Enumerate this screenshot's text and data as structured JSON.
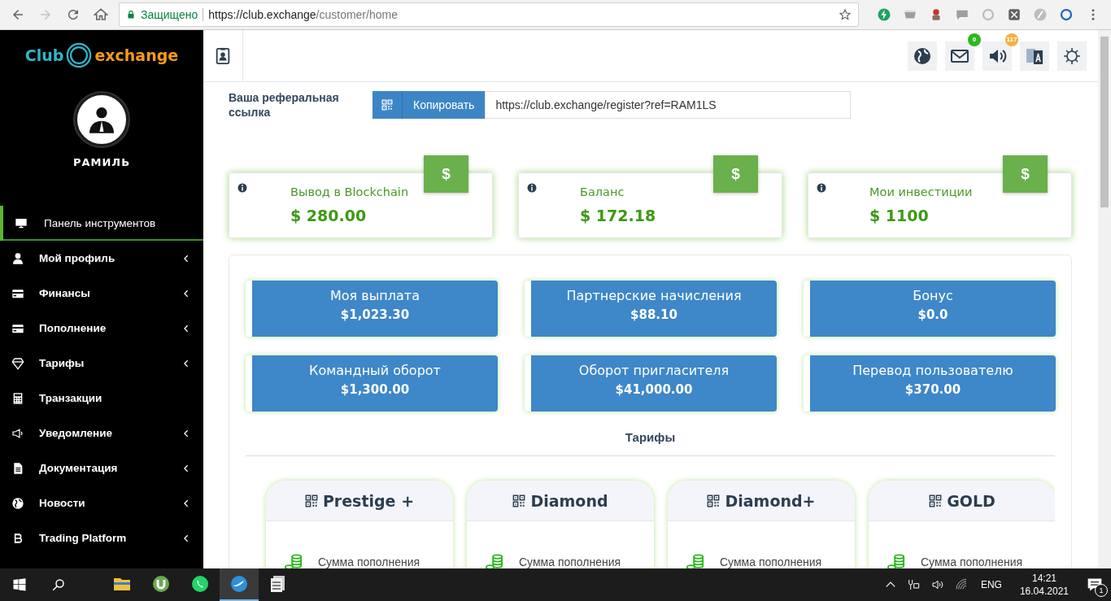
{
  "browser": {
    "secure_label": "Защищено",
    "url_host": "https://club.exchange",
    "url_path": "/customer/home",
    "extensions": [
      {
        "kind": "bolt",
        "color": "#1aa260"
      },
      {
        "kind": "cup",
        "color": "#9e9e9e"
      },
      {
        "kind": "figure",
        "color": "#c0392b"
      },
      {
        "kind": "chat",
        "color": "#9e9e9e"
      },
      {
        "kind": "ring",
        "color": "#bdbdbd"
      },
      {
        "kind": "square",
        "color": "#616161"
      },
      {
        "kind": "slash",
        "color": "#bdbdbd"
      },
      {
        "kind": "ring",
        "color": "#1e63c9"
      }
    ]
  },
  "sidebar": {
    "logo": {
      "part1": "Club",
      "part2": "exchange"
    },
    "user_name": "РАМИЛЬ",
    "items": [
      {
        "label": "Панель инструментов",
        "kind": "monitor",
        "selected": true,
        "submenu": false
      },
      {
        "label": "Мой профиль",
        "kind": "user",
        "selected": false,
        "submenu": true
      },
      {
        "label": "Финансы",
        "kind": "card",
        "selected": false,
        "submenu": true
      },
      {
        "label": "Пополнение",
        "kind": "card",
        "selected": false,
        "submenu": true
      },
      {
        "label": "Тарифы",
        "kind": "diamond",
        "selected": false,
        "submenu": true
      },
      {
        "label": "Транзакции",
        "kind": "calculator",
        "selected": false,
        "submenu": false
      },
      {
        "label": "Уведомление",
        "kind": "megaphone",
        "selected": false,
        "submenu": true
      },
      {
        "label": "Документация",
        "kind": "file",
        "selected": false,
        "submenu": true
      },
      {
        "label": "Новости",
        "kind": "globe",
        "selected": false,
        "submenu": true
      },
      {
        "label": "Trading Platform",
        "kind": "bitcoin",
        "selected": false,
        "submenu": true
      }
    ]
  },
  "topbar": {
    "buttons": [
      {
        "kind": "globe"
      },
      {
        "kind": "mail",
        "badge": "0",
        "color": "#2db81f"
      },
      {
        "kind": "volume",
        "badge": "117",
        "color": "#f5b041"
      },
      {
        "kind": "translate"
      },
      {
        "kind": "settings"
      }
    ]
  },
  "referral": {
    "label": "Ваша реферальная ссылка",
    "button": "Копировать",
    "value": "https://club.exchange/register?ref=RAM1LS"
  },
  "stats": [
    {
      "title": "Вывод в Blockchain",
      "amount": "$ 280.00",
      "badge": "$"
    },
    {
      "title": "Баланс",
      "amount": "$ 172.18",
      "badge": "$"
    },
    {
      "title": "Мои инвестиции",
      "amount": "$ 1100",
      "badge": "$"
    }
  ],
  "tiles": [
    {
      "title": "Моя выплата",
      "amount": "$1,023.30"
    },
    {
      "title": "Партнерские начисления",
      "amount": "$88.10"
    },
    {
      "title": "Бонус",
      "amount": "$0.0"
    },
    {
      "title": "Командный оборот",
      "amount": "$1,300.00"
    },
    {
      "title": "Оборот пригласителя",
      "amount": "$41,000.00"
    },
    {
      "title": "Перевод пользователю",
      "amount": "$370.00"
    }
  ],
  "tariffs": {
    "title": "Тарифы",
    "plans": [
      {
        "name": "Prestige +",
        "row_label": "Сумма пополнения"
      },
      {
        "name": "Diamond",
        "row_label": "Сумма пополнения"
      },
      {
        "name": "Diamond+",
        "row_label": "Сумма пополнения"
      },
      {
        "name": "GOLD",
        "row_label": "Сумма пополнения"
      }
    ]
  },
  "taskbar": {
    "apps": [
      {
        "kind": "folder",
        "selected": false
      },
      {
        "kind": "torrent",
        "selected": false
      },
      {
        "kind": "phone",
        "selected": false
      },
      {
        "kind": "bird",
        "selected": true
      },
      {
        "kind": "docs",
        "selected": false
      }
    ],
    "language": "ENG",
    "time": "14:21",
    "date": "16.04.2021",
    "notifications": "1"
  }
}
